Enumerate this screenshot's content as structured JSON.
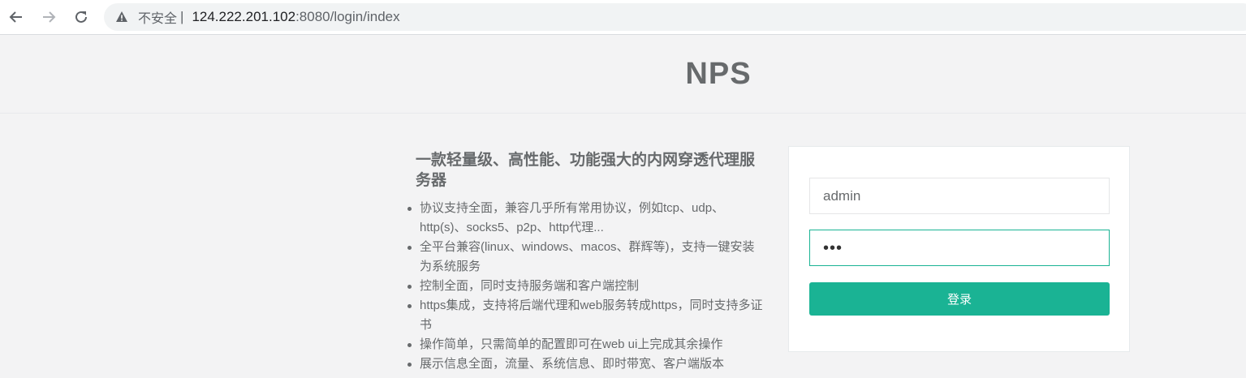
{
  "browser": {
    "insecure_label": "不安全",
    "separator": "|",
    "url_host": "124.222.201.102",
    "url_rest": ":8080/login/index"
  },
  "header": {
    "logo": "NPS"
  },
  "intro": {
    "title": "一款轻量级、高性能、功能强大的内网穿透代理服务器",
    "features": [
      "协议支持全面，兼容几乎所有常用协议，例如tcp、udp、http(s)、socks5、p2p、http代理...",
      "全平台兼容(linux、windows、macos、群辉等)，支持一键安装为系统服务",
      "控制全面，同时支持服务端和客户端控制",
      "https集成，支持将后端代理和web服务转成https，同时支持多证书",
      "操作简单，只需简单的配置即可在web ui上完成其余操作",
      "展示信息全面，流量、系统信息、即时带宽、客户端版本"
    ]
  },
  "login": {
    "username_value": "admin",
    "password_mask": "•••",
    "submit_label": "登录"
  },
  "colors": {
    "accent": "#1ab394",
    "text": "#676a6c",
    "background": "#f3f3f4"
  },
  "icons": [
    "back-arrow-icon",
    "forward-arrow-icon",
    "reload-icon",
    "warning-icon"
  ]
}
